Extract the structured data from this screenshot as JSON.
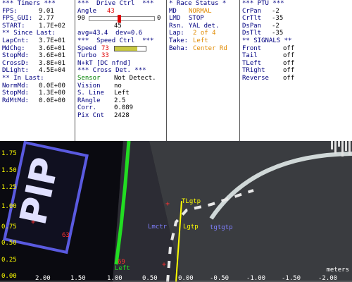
{
  "timers": {
    "title": "*** Timers ***",
    "fps_label": "FPS:",
    "fps": "9.01",
    "fpsgui_label": "FPS_GUI:",
    "fpsgui": "2.77",
    "start_label": "START:",
    "start": "1.7E+02",
    "since_last": "** Since Last:",
    "lapcnt_label": "LapCnt:",
    "lapcnt": "3.7E+01",
    "mdchg_label": "MdChg:",
    "mdchg": "3.6E+01",
    "stopmd_label": "StopMd:",
    "stopmd": "3.6E+01",
    "crossd_label": "CrossD:",
    "crossd": "3.8E+01",
    "dlight_label": "DLight:",
    "dlight": "4.5E+04",
    "in_last": "** In Last:",
    "normmd_label": "NormMd:",
    "normmd": "0.0E+00",
    "stopmd2_label": "StopMd:",
    "stopmd2": "1.3E+00",
    "rdmtmd_label": "RdMtMd:",
    "rdmtmd": "0.0E+00"
  },
  "drive": {
    "title": "***  Drive Ctrl  ***",
    "angle_label": "Angle",
    "angle": "43",
    "slider_min": "90",
    "slider_max": "0",
    "slider_mid": "45",
    "avg": "avg=43.4  dev=0.6",
    "speed_title": "***  Speed Ctrl  ***",
    "speed_label": "Speed",
    "speed": "73",
    "turbo_label": "Turbo",
    "turbo": "33",
    "nkt": "N+kT [DC nfnd]",
    "cross_title": "*** Cross Det. ***",
    "sensor_label": "Sensor",
    "sensor": "Not Detect.",
    "vision_label": "Vision",
    "vision": "no",
    "sline_label": "S. Line",
    "sline": "Left",
    "rangle_label": "RAngle",
    "rangle": "2.5",
    "corr_label": "Corr.",
    "corr": "0.089",
    "pixcnt_label": "Pix Cnt",
    "pixcnt": "2428"
  },
  "race": {
    "title": "* Race Status *",
    "md_label": "MD",
    "md": "NORMAL",
    "lmd_label": "LMD",
    "lmd": "STOP",
    "rsn_label": "Rsn.",
    "rsn": "YAL det.",
    "lap_label": "Lap:",
    "lap": "2 of 4",
    "take_label": "Take:",
    "take": "Left",
    "beha_label": "Beha:",
    "beha": "Center Rd"
  },
  "ptu": {
    "title": "*** PTU ***",
    "crpan_label": "CrPan",
    "crpan": "-2",
    "crtilt_label": "CrTlt",
    "crtilt": "-35",
    "dspan_label": "DsPan",
    "dspan": "-2",
    "dstilt_label": "DsTlt",
    "dstilt": "-35",
    "signals_title": "** SIGNALS **",
    "front_label": "Front",
    "front": "off",
    "tail_label": "Tail",
    "tail": "off",
    "tleft_label": "TLeft",
    "tleft": "off",
    "tright_label": "TRight",
    "tright": "off",
    "reverse_label": "Reverse",
    "reverse": "off"
  },
  "camera": {
    "y_labels": [
      "1.75",
      "1.50",
      "1.25",
      "1.00",
      "0.75",
      "0.50",
      "0.25",
      "0.00"
    ],
    "x_labels": [
      "2.00",
      "1.50",
      "1.00",
      "0.50",
      "0.00",
      "-0.50",
      "-1.00",
      "-1.50",
      "-2.00"
    ],
    "units": "meters",
    "markers": {
      "tlgtp": "TLgtp",
      "lgtp": "Lgtp",
      "lmctr": "Lmctr",
      "tgtgtp": "tgtgtp",
      "l63": "63",
      "l69": "69",
      "left": "Left"
    }
  },
  "colors": {
    "label": "#000080",
    "highlight_red": "#e00000",
    "highlight_orange": "#e08a00",
    "sensor_green": "#008000",
    "lane_green": "#22dd22",
    "target_yellow": "#ffff00"
  }
}
